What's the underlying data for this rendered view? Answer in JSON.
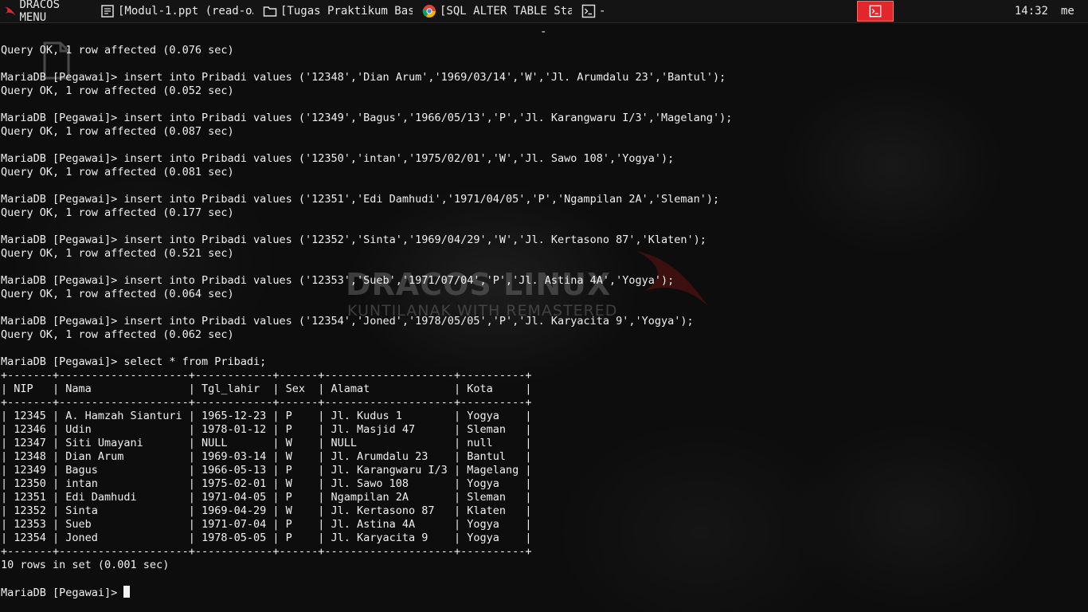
{
  "taskbar": {
    "menu_label": "DRACOS MENU",
    "tasks": [
      {
        "label": "[Modul-1.ppt (read-o…",
        "icon": "document-icon"
      },
      {
        "label": "[Tugas Praktikum Bas…",
        "icon": "folder-icon"
      },
      {
        "label": "[SQL ALTER TABLE Sta…",
        "icon": "chrome-icon"
      },
      {
        "label": "-",
        "icon": "terminal-icon"
      }
    ],
    "tray_icon": "terminal-icon",
    "tray_color": "#e1262c",
    "clock": "14:32",
    "user": "me"
  },
  "desktop": {
    "watermark_title": "DRACOS LINUX",
    "watermark_subtitle": "KUNTILANAK WITH REMASTERED"
  },
  "top_dash": "-",
  "terminal": {
    "lines": [
      "Query OK, 1 row affected (0.076 sec)",
      "",
      "MariaDB [Pegawai]> insert into Pribadi values ('12348','Dian Arum','1969/03/14','W','Jl. Arumdalu 23','Bantul');",
      "Query OK, 1 row affected (0.052 sec)",
      "",
      "MariaDB [Pegawai]> insert into Pribadi values ('12349','Bagus','1966/05/13','P','Jl. Karangwaru I/3','Magelang');",
      "Query OK, 1 row affected (0.087 sec)",
      "",
      "MariaDB [Pegawai]> insert into Pribadi values ('12350','intan','1975/02/01','W','Jl. Sawo 108','Yogya');",
      "Query OK, 1 row affected (0.081 sec)",
      "",
      "MariaDB [Pegawai]> insert into Pribadi values ('12351','Edi Damhudi','1971/04/05','P','Ngampilan 2A','Sleman');",
      "Query OK, 1 row affected (0.177 sec)",
      "",
      "MariaDB [Pegawai]> insert into Pribadi values ('12352','Sinta','1969/04/29','W','Jl. Kertasono 87','Klaten');",
      "Query OK, 1 row affected (0.521 sec)",
      "",
      "MariaDB [Pegawai]> insert into Pribadi values ('12353','Sueb','1971/07/04','P','Jl. Astina 4A','Yogya');",
      "Query OK, 1 row affected (0.064 sec)",
      "",
      "MariaDB [Pegawai]> insert into Pribadi values ('12354','Joned','1978/05/05','P','Jl. Karyacita 9','Yogya');",
      "Query OK, 1 row affected (0.062 sec)",
      "",
      "MariaDB [Pegawai]> select * from Pribadi;",
      "+-------+--------------------+------------+------+--------------------+----------+",
      "| NIP   | Nama               | Tgl_lahir  | Sex  | Alamat             | Kota     |",
      "+-------+--------------------+------------+------+--------------------+----------+",
      "| 12345 | A. Hamzah Sianturi | 1965-12-23 | P    | Jl. Kudus 1        | Yogya    |",
      "| 12346 | Udin               | 1978-01-12 | P    | Jl. Masjid 47      | Sleman   |",
      "| 12347 | Siti Umayani       | NULL       | W    | NULL               | null     |",
      "| 12348 | Dian Arum          | 1969-03-14 | W    | Jl. Arumdalu 23    | Bantul   |",
      "| 12349 | Bagus              | 1966-05-13 | P    | Jl. Karangwaru I/3 | Magelang |",
      "| 12350 | intan              | 1975-02-01 | W    | Jl. Sawo 108       | Yogya    |",
      "| 12351 | Edi Damhudi        | 1971-04-05 | P    | Ngampilan 2A       | Sleman   |",
      "| 12352 | Sinta              | 1969-04-29 | W    | Jl. Kertasono 87   | Klaten   |",
      "| 12353 | Sueb               | 1971-07-04 | P    | Jl. Astina 4A      | Yogya    |",
      "| 12354 | Joned              | 1978-05-05 | P    | Jl. Karyacita 9    | Yogya    |",
      "+-------+--------------------+------------+------+--------------------+----------+",
      "10 rows in set (0.001 sec)",
      ""
    ],
    "prompt": "MariaDB [Pegawai]> "
  }
}
